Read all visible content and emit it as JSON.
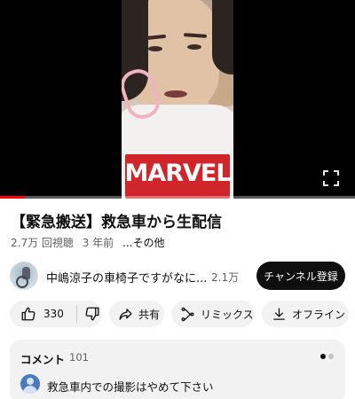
{
  "video": {
    "shirt_logo": "MARVEL",
    "progress_fraction": 0.07
  },
  "title": "【緊急搬送】救急車から生配信",
  "meta": {
    "views": "2.7万 回視聴",
    "age": "3 年前",
    "more": "...その他"
  },
  "channel": {
    "name": "中嶋涼子の車椅子ですがなに...",
    "subscribers": "2.1万",
    "subscribe_label": "チャンネル登録"
  },
  "actions": {
    "like_count": "330",
    "share_label": "共有",
    "remix_label": "リミックス",
    "offline_label": "オフライン"
  },
  "comments": {
    "title": "コメント",
    "count": "101",
    "top_comment": "救急車内での撮影はやめて下さい"
  },
  "icons": {
    "fullscreen": "fullscreen-icon",
    "like": "thumbs-up-icon",
    "dislike": "thumbs-down-icon",
    "share": "share-arrow-icon",
    "remix": "remix-icon",
    "download": "download-icon"
  },
  "colors": {
    "progress": "#ff0000",
    "subscribe_bg": "#0f0f0f",
    "chip_bg": "#f2f2f2",
    "logo_red": "#d0252b"
  }
}
